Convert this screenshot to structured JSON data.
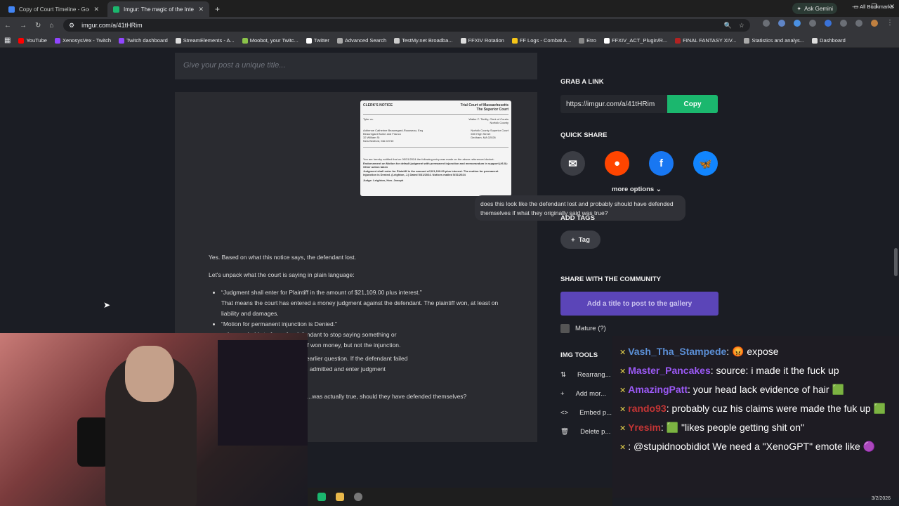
{
  "tabs": [
    {
      "title": "Copy of Court Timeline - Goog",
      "color": "#4285f4",
      "active": false
    },
    {
      "title": "Imgur: The magic of the Intern",
      "color": "#1bb76e",
      "active": true
    }
  ],
  "browser": {
    "new_tab": "+",
    "gemini_label": "Ask Gemini",
    "url": "imgur.com/a/41tHRim",
    "all_bookmarks": "All Bookmarks"
  },
  "bookmarks": [
    {
      "label": "YouTube",
      "color": "#ff0000"
    },
    {
      "label": "XenosysVex - Twitch",
      "color": "#9146ff"
    },
    {
      "label": "Twitch dashboard",
      "color": "#9146ff"
    },
    {
      "label": "StreamElements - A...",
      "color": "#dddddd"
    },
    {
      "label": "Moobot, your Twitc...",
      "color": "#8bc34a"
    },
    {
      "label": "Twitter",
      "color": "#ffffff"
    },
    {
      "label": "Advanced Search",
      "color": "#aaaaaa"
    },
    {
      "label": "TestMy.net Broadba...",
      "color": "#cccccc"
    },
    {
      "label": "FFXIV Rotation",
      "color": "#dddddd"
    },
    {
      "label": "FF Logs - Combat A...",
      "color": "#f5c518"
    },
    {
      "label": "Etro",
      "color": "#888888"
    },
    {
      "label": "FFXIV_ACT_Plugin/R...",
      "color": "#ffffff"
    },
    {
      "label": "FINAL FANTASY XIV...",
      "color": "#b22222"
    },
    {
      "label": "Statistics and analys...",
      "color": "#aaaaaa"
    },
    {
      "label": "Dashboard",
      "color": "#dddddd"
    }
  ],
  "post": {
    "title_placeholder": "Give your post a unique title...",
    "notice": {
      "left_header": "CLERK'S NOTICE",
      "right_header_1": "Trial Court of Massachusetts",
      "right_header_2": "The Superior Court",
      "line_1": "Tyler vs.",
      "addr_1": "Adrienne Catherine Beauregard-Rousseau, Esq",
      "addr_2": "Beauregard Burke and Franco",
      "addr_3": "32 William St",
      "addr_4": "New Bedford, MA 02740",
      "court_1": "Norfolk County Superior Court",
      "court_2": "650 High Street",
      "court_3": "Dedham, MA 02026",
      "clerk": "Walter F. Timilty, Clerk of Courts",
      "county": "Norfolk County",
      "body_1": "You are hereby notified that on 05/31/2024 the following entry was made on the above referenced docket:",
      "body_2": "Endorsement on Motion for default judgment with permanent injunction and memorandum in support (#6.0): Other action taken",
      "body_3": "Judgment shall enter for Plaintiff in the amount of $21,109.00 plus interest. The motion for permanent injunction is Denied. (Leighton, J.) Dated 5/31/2024. Notices mailed 5/31/2024",
      "judge": "Judge: Leighton, Hon. Joseph"
    },
    "question": "does this look like the defendant lost and probably should have defended themselves if what they originally said was true?",
    "answer_1": "Yes. Based on what this notice says, the defendant lost.",
    "answer_2": "Let's unpack what the court is saying in plain language:",
    "bullet_1_quote": "“Judgment shall enter for Plaintiff in the amount of $21,109.00 plus interest.”",
    "bullet_1_text": "That means the court has entered a money judgment against the defendant. The plaintiff won, at least on liability and damages.",
    "bullet_2_quote": "“Motion for permanent injunction is Denied.”",
    "bullet_2_text_a": "...tion, probably to force the defendant to stop saying something or",
    "bullet_2_text_b": "...denied that part. So the plaintiff won money, but not the injunction.",
    "para_3a": "...ent situation, especially given your earlier question. If the defendant failed",
    "para_3b": "...uld treat the plaintiff's allegations as admitted and enter judgment",
    "question_2": "...was actually true, should they have defended themselves?"
  },
  "sidebar": {
    "grab_link": "GRAB A LINK",
    "link_url": "https://imgur.com/a/41tHRim",
    "copy": "Copy",
    "quick_share": "QUICK SHARE",
    "more_options": "more options",
    "add_tags": "ADD TAGS",
    "tag": "Tag",
    "share_community": "SHARE WITH THE COMMUNITY",
    "add_title_gallery": "Add a title to post to the gallery",
    "mature": "Mature (?)",
    "img_tools": "IMG TOOLS",
    "tools": [
      "Rearrang...",
      "Add mor...",
      "Embed p...",
      "Delete p..."
    ]
  },
  "chat": [
    {
      "user": "Vash_Tha_Stampede",
      "color": "#5b8fd6",
      "text": ": 😡 expose"
    },
    {
      "user": "Master_Pancakes",
      "color": "#9b59f5",
      "text": ": source: i made it the fuck up"
    },
    {
      "user": "AmazingPatt",
      "color": "#9b59f5",
      "text": ": your head lack evidence of hair 🟩"
    },
    {
      "user": "rando93",
      "color": "#c43535",
      "text": ": probably cuz his claims were made the fuk up 🟩"
    },
    {
      "user": "Yresim",
      "color": "#c43535",
      "text": ": 🟩 \"likes people getting shit on\""
    },
    {
      "user": "",
      "color": "#ffffff",
      "text": ": @stupidnoobidiot We need a \"XenoGPT\" emote like 🟣"
    }
  ],
  "taskbar": {
    "date": "3/2/2026"
  }
}
